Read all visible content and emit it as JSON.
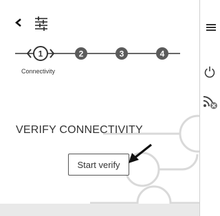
{
  "header": {
    "back_icon": "chevron-left-icon",
    "settings_icon": "sliders-icon"
  },
  "stepper": {
    "steps": [
      {
        "number": "1",
        "label": "Connectivity",
        "active": true
      },
      {
        "number": "2",
        "label": "",
        "active": false
      },
      {
        "number": "3",
        "label": "",
        "active": false
      },
      {
        "number": "4",
        "label": "",
        "active": false
      }
    ]
  },
  "main": {
    "title": "VERIFY CONNECTIVITY",
    "verify_button_label": "Start verify"
  },
  "sidebar": {
    "icons": [
      "menu-icon",
      "power-icon",
      "rss-offline-icon"
    ]
  },
  "colors": {
    "accent": "#555555",
    "decoration": "#d9d9d9",
    "panel": "#ffffff",
    "background": "#e4e4e4"
  }
}
